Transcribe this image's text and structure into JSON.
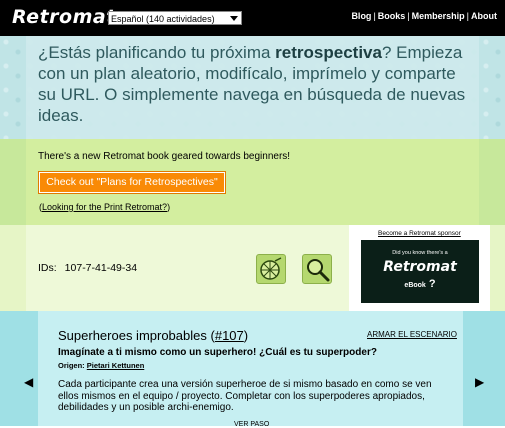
{
  "header": {
    "logo": "Retromat",
    "language_select": "Español (140 actividades)",
    "nav": [
      "Blog",
      "Books",
      "Membership",
      "About"
    ]
  },
  "intro": {
    "pre": "¿Estás planificando tu próxima ",
    "bold": "retrospectiva",
    "post": "? Empieza con un plan aleatorio, modifícalo, imprímelo y comparte su URL. O simplemente navega en búsqueda de nuevas ideas."
  },
  "book": {
    "note": "There's a new Retromat book geared towards beginners!",
    "button": "Check out \"Plans for Retrospectives\"",
    "print_open": "(",
    "print_link": "Looking for the Print Retromat?",
    "print_close": ")"
  },
  "ids": {
    "label": "IDs:",
    "value": "107-7-41-49-34"
  },
  "icons": [
    "random-plan-icon",
    "search-icon"
  ],
  "sponsor": {
    "link": "Become a Retromat sponsor",
    "ad_line1": "Did you know there's a",
    "ad_line2": "Retromat",
    "ad_line3": "eBook",
    "ad_q": "?"
  },
  "activity": {
    "title": "Superheroes improbables",
    "id_open": "(",
    "id_link": "#107",
    "id_close": ")",
    "arrange": "ARMAR EL ESCENARIO",
    "subtitle": "Imagínate a ti mismo como un superhero! ¿Cuál es tu superpoder?",
    "origin_label": "Origen:",
    "origin_name": "Pietari Kettunen",
    "description": "Cada participante crea una versión superheroe de si mismo basado en como se ven ellos mismos en el equipo / proyecto. Completar con los superpoderes apropiados, debilidades y un posible archi-enemigo.",
    "more": "VER PASO",
    "prev_arrow": "◀",
    "next_arrow": "▶"
  },
  "colors": {
    "topbar": "#000000",
    "intro_bg": "#c0e4e6",
    "green_bg": "#c7e89b",
    "button": "#f98a06",
    "activity_bg": "#9fe0e5"
  }
}
